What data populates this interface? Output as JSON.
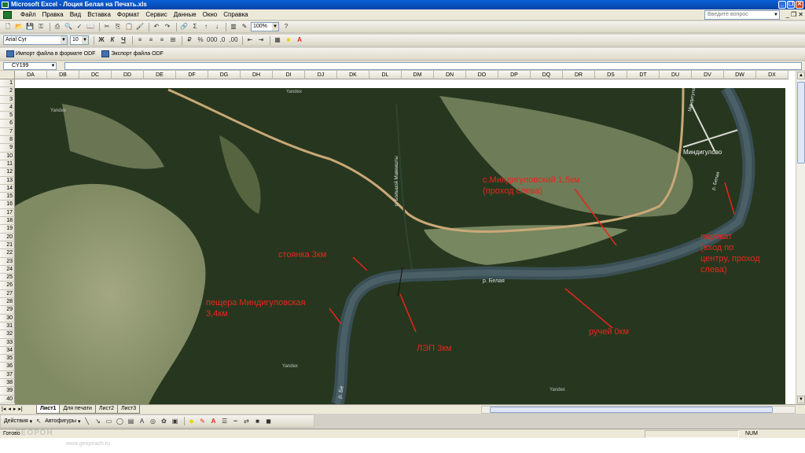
{
  "window": {
    "title": "Microsoft Excel - Лоция Белая на Печать.xls"
  },
  "menu": {
    "items": [
      "Файл",
      "Правка",
      "Вид",
      "Вставка",
      "Формат",
      "Сервис",
      "Данные",
      "Окно",
      "Справка"
    ],
    "help_placeholder": "Введите вопрос"
  },
  "toolbar_standard": {
    "zoom": "100%"
  },
  "toolbar_format": {
    "font": "Arial Cyr",
    "size": "10",
    "bold": "Ж",
    "italic": "К",
    "underline": "Ч"
  },
  "toolbar_odf": {
    "import_label": "Импорт файла в формате ODF",
    "export_label": "Экспорт файла ODF"
  },
  "formula_bar": {
    "name_box": "CY199",
    "formula": ""
  },
  "columns": [
    "DA",
    "DB",
    "DC",
    "DD",
    "DE",
    "DF",
    "DG",
    "DH",
    "DI",
    "DJ",
    "DK",
    "DL",
    "DM",
    "DN",
    "DO",
    "DP",
    "DQ",
    "DR",
    "DS",
    "DT",
    "DU",
    "DV",
    "DW",
    "DX"
  ],
  "rows": [
    "1",
    "2",
    "3",
    "4",
    "5",
    "6",
    "7",
    "8",
    "9",
    "10",
    "11",
    "12",
    "13",
    "14",
    "15",
    "16",
    "17",
    "18",
    "19",
    "20",
    "21",
    "22",
    "23",
    "24",
    "25",
    "26",
    "27",
    "28",
    "29",
    "30",
    "31",
    "32",
    "33",
    "34",
    "35",
    "36",
    "37",
    "38",
    "39",
    "40"
  ],
  "map": {
    "labels": {
      "river_main": "р. Белая",
      "river_bottom": "р. Бе",
      "river_tributary": "р. Большой Мавеишты",
      "village": "Миндигулово",
      "road_sign": "Миндигулово",
      "right_river": "р. Белая",
      "yandex": "Yandex"
    },
    "annotations": {
      "village_line1": "с.Миндигуловский 1,5км",
      "village_line2": "(проход слева)",
      "camp": "стоянка 3км",
      "cave_line1": "пещера Миндигуловская",
      "cave_line2": "3,4км",
      "powerline": "ЛЭП 3км",
      "creek": "ручей 0км",
      "rift_line1": "перекат",
      "rift_line2": "(вход по",
      "rift_line3": "центру, проход",
      "rift_line4": "слева)"
    },
    "annotation_color": "#e8251c"
  },
  "sheet_tabs": {
    "items": [
      "Лист1",
      "Для печати",
      "Лист2",
      "Лист3"
    ],
    "active": "Лист1"
  },
  "drawing_toolbar": {
    "actions": "Действия",
    "autoshapes": "Автофигуры"
  },
  "status": {
    "ready": "Готово",
    "num": "NUM"
  },
  "watermark": {
    "text": "ГЕОРОН",
    "url": "www.geoptrach.ru"
  }
}
